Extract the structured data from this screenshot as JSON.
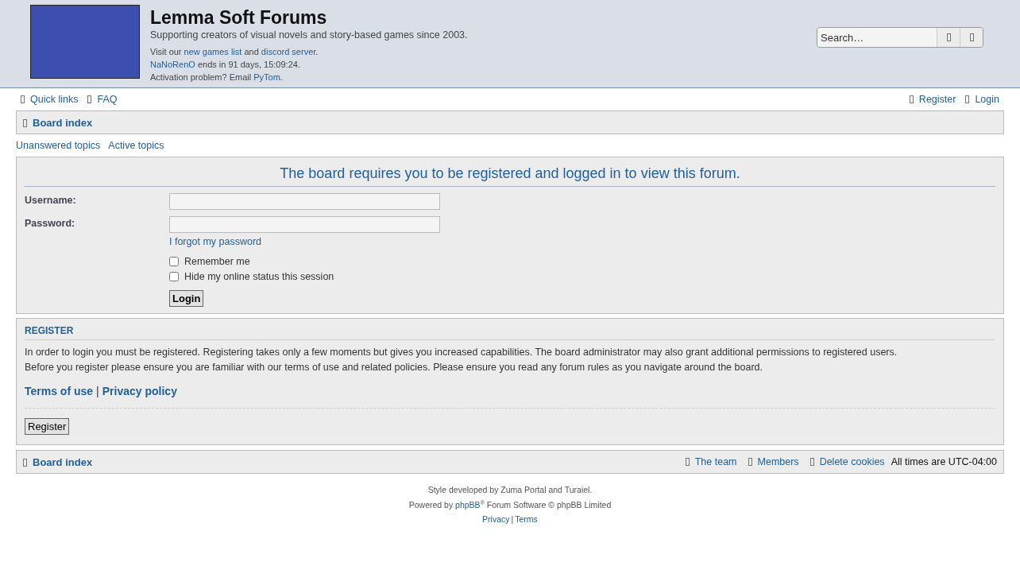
{
  "header": {
    "site_title": "Lemma Soft Forums",
    "tagline": "Supporting creators of visual novels and story-based games since 2003.",
    "notices": [
      [
        {
          "text": "Visit our ",
          "link": false
        },
        {
          "text": "new games list",
          "link": true
        },
        {
          "text": " and ",
          "link": false
        },
        {
          "text": "discord server",
          "link": true
        },
        {
          "text": ".",
          "link": false
        }
      ],
      [
        {
          "text": "NaNoRenO",
          "link": true
        },
        {
          "text": " ends in 91 days, 15:09:24.",
          "link": false
        }
      ],
      [
        {
          "text": "Activation problem? Email ",
          "link": false
        },
        {
          "text": "PyTom",
          "link": true
        },
        {
          "text": ".",
          "link": false
        }
      ]
    ],
    "search": {
      "placeholder": "Search…"
    }
  },
  "nav_left": [
    "Quick links",
    "FAQ"
  ],
  "nav_right": [
    "Register",
    "Login"
  ],
  "breadcrumb": "Board index",
  "quick_links": [
    "Unanswered topics",
    "Active topics"
  ],
  "login_panel": {
    "heading": "The board requires you to be registered and logged in to view this forum.",
    "fields": [
      {
        "label": "Username:"
      },
      {
        "label": "Password:"
      }
    ],
    "forgot_link": "I forgot my password",
    "checkboxes": [
      {
        "label": "Remember me",
        "checked": false
      },
      {
        "label": "Hide my online status this session",
        "checked": false
      }
    ],
    "button": "Login"
  },
  "register_panel": {
    "heading": "REGISTER",
    "paragraph_lines": [
      "In order to login you must be registered. Registering takes only a few moments but gives you increased capabilities. The board administrator may also grant additional permissions to registered users.",
      "Before you register please ensure you are familiar with our terms of use and related policies. Please ensure you read any forum rules as you navigate around the board."
    ],
    "links": [
      "Terms of use",
      "Privacy policy"
    ],
    "separator": "|",
    "button": "Register"
  },
  "footer_bar": {
    "breadcrumb": "Board index",
    "links": [
      "The team",
      "Members",
      "Delete cookies"
    ],
    "timezone_label": "All times are ",
    "timezone": "UTC-04:00"
  },
  "credits": {
    "style_line": "Style developed by Zuma Portal and Turaiel.",
    "powered_prefix": "Powered by ",
    "powered_link": "phpBB",
    "powered_mark": "®",
    "powered_suffix": " Forum Software © phpBB Limited",
    "links": [
      "Privacy",
      "Terms"
    ],
    "separator": "|"
  }
}
